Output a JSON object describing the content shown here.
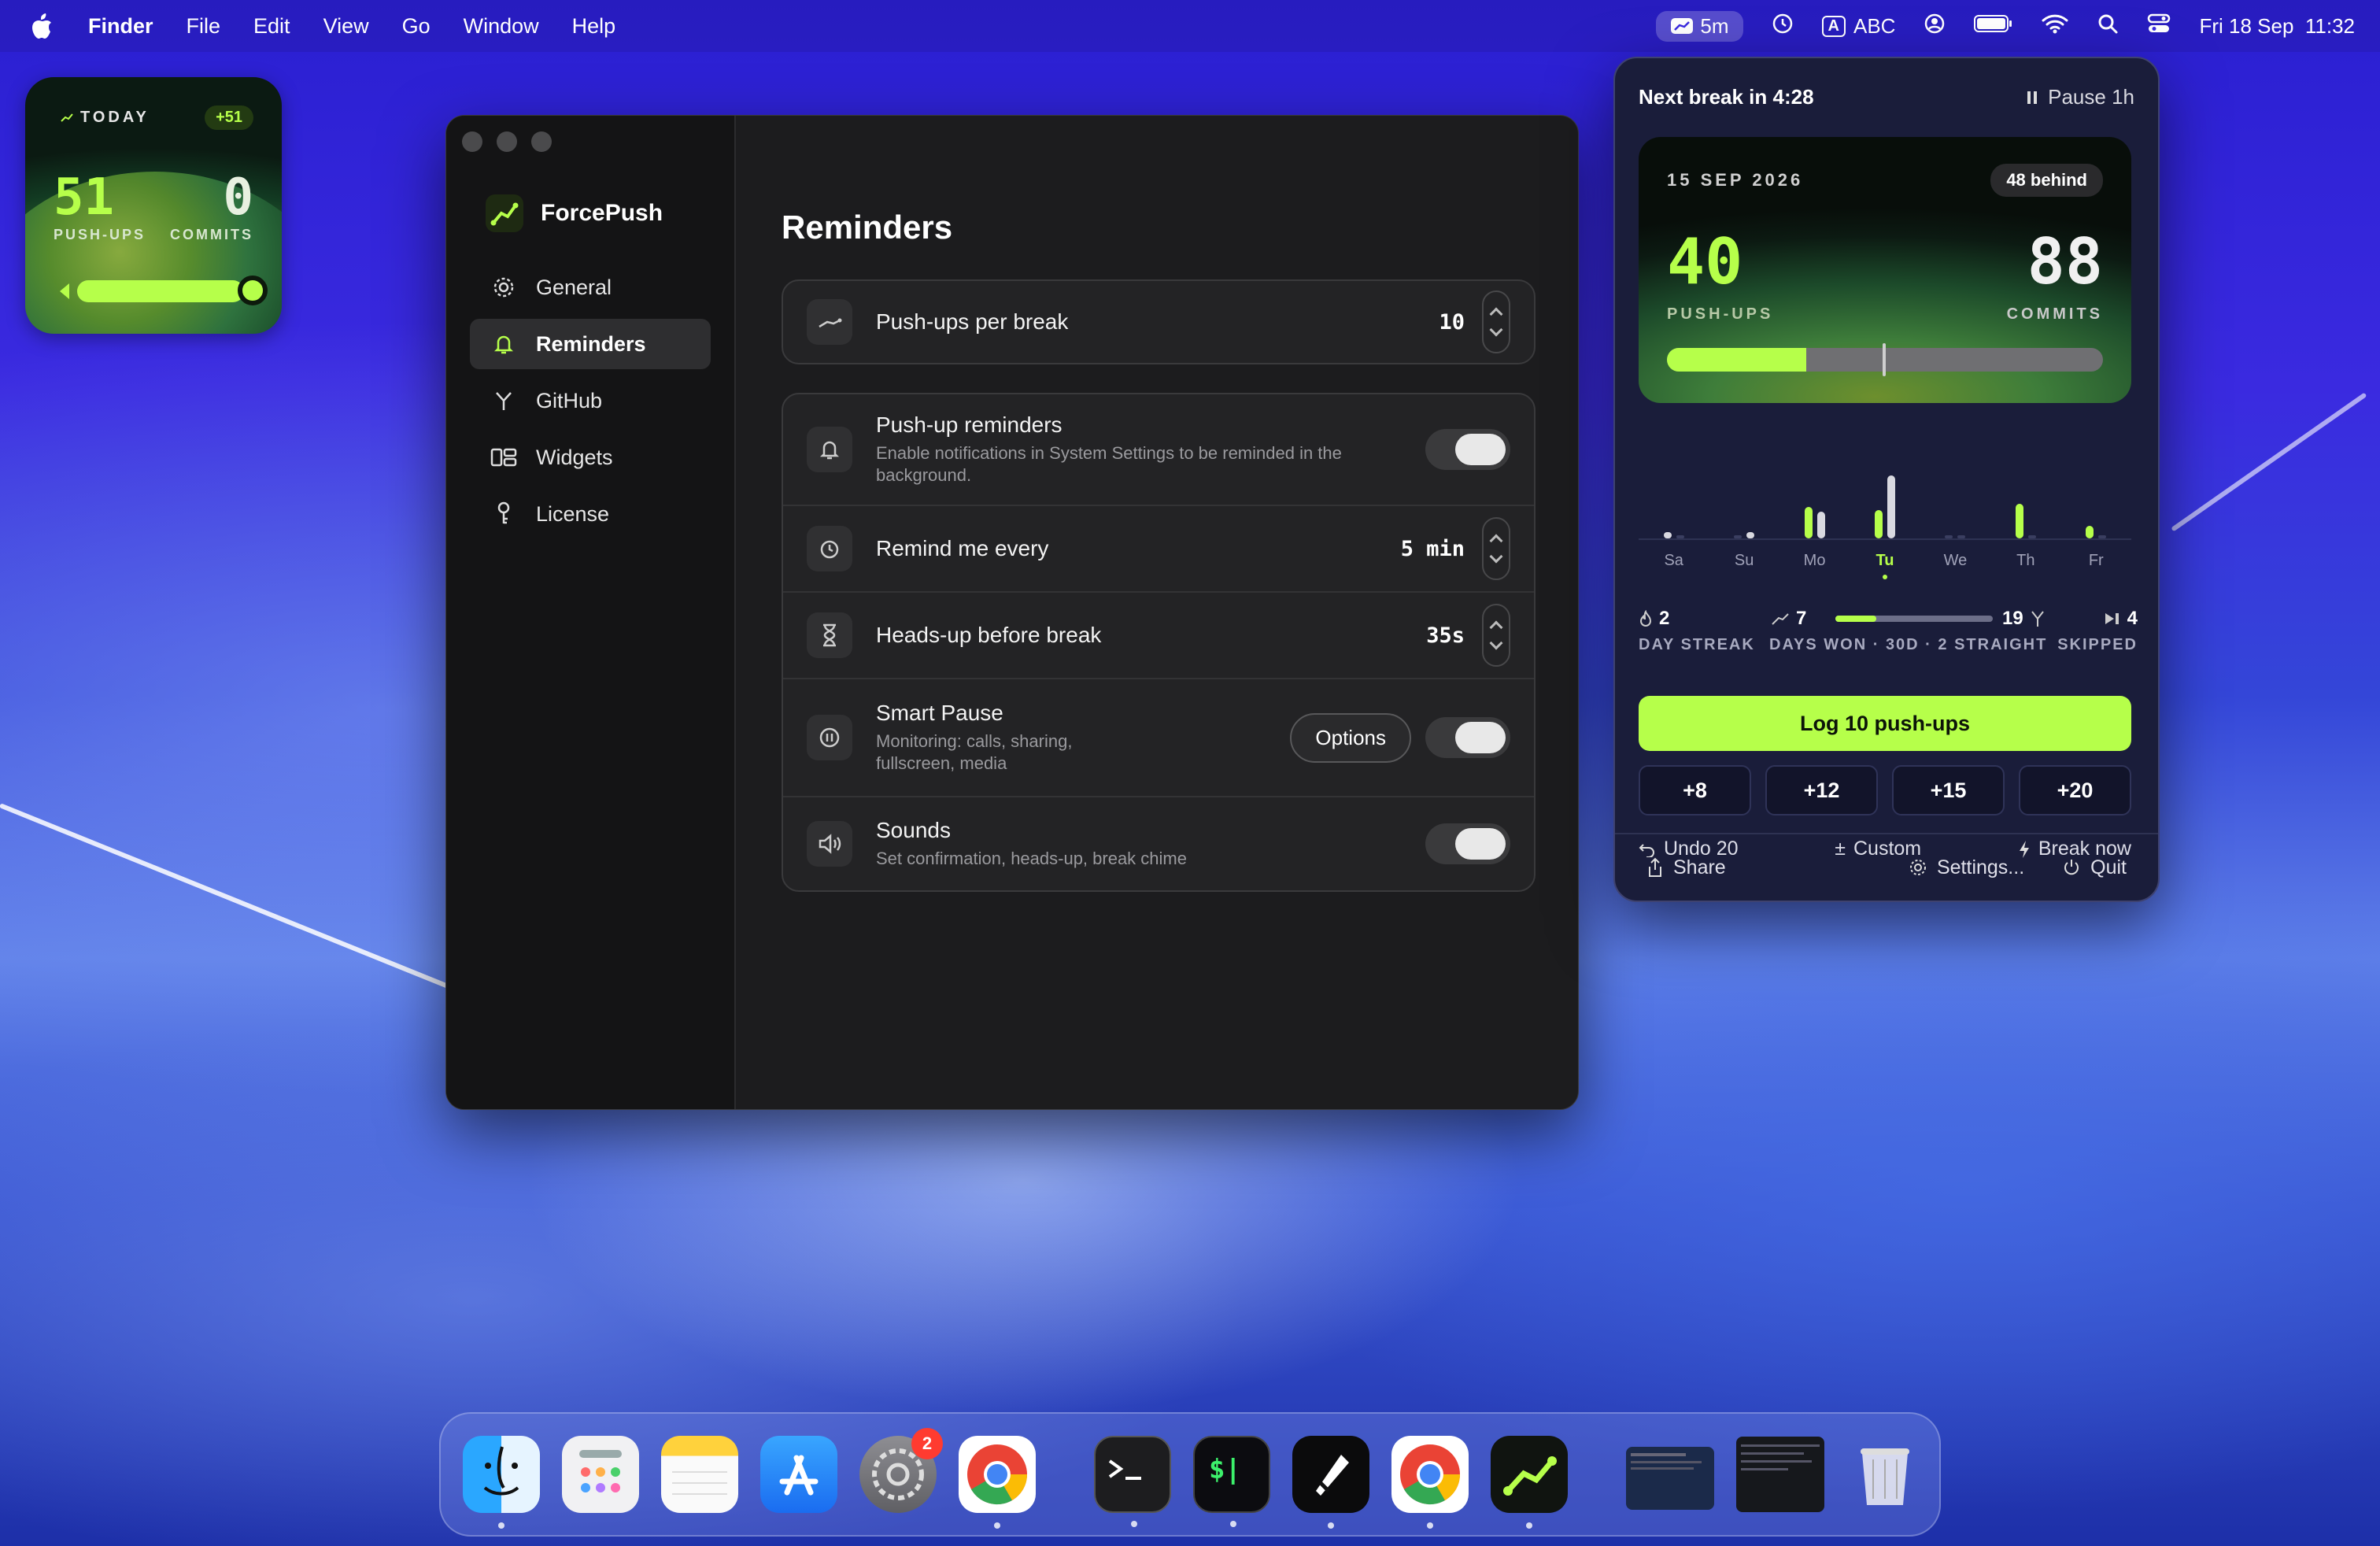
{
  "menubar": {
    "app": "Finder",
    "menus": [
      "File",
      "Edit",
      "View",
      "Go",
      "Window",
      "Help"
    ],
    "timer": "5m",
    "input_source_letter": "A",
    "input_source": "ABC",
    "clock": "Fri 18 Sep  11:32"
  },
  "widget": {
    "label": "TODAY",
    "badge": "+51",
    "pushups": "51",
    "pushups_label": "PUSH-UPS",
    "commits": "0",
    "commits_label": "COMMITS"
  },
  "window": {
    "app_name": "ForcePush",
    "sidebar": [
      {
        "label": "General",
        "icon": "gear-icon"
      },
      {
        "label": "Reminders",
        "icon": "bell-icon",
        "active": true
      },
      {
        "label": "GitHub",
        "icon": "branch-icon"
      },
      {
        "label": "Widgets",
        "icon": "widgets-icon"
      },
      {
        "label": "License",
        "icon": "key-icon"
      }
    ],
    "title": "Reminders",
    "pushups_per_break": {
      "label": "Push-ups per break",
      "value": "10"
    },
    "rows": {
      "reminders": {
        "title": "Push-up reminders",
        "desc": "Enable notifications in System Settings to be reminded in the background."
      },
      "remind_every": {
        "title": "Remind me every",
        "value": "5 min"
      },
      "heads_up": {
        "title": "Heads-up before break",
        "value": "35s"
      },
      "smart_pause": {
        "title": "Smart Pause",
        "desc": "Monitoring: calls, sharing, fullscreen, media",
        "button": "Options"
      },
      "sounds": {
        "title": "Sounds",
        "desc": "Set confirmation, heads-up, break chime"
      }
    }
  },
  "popover": {
    "next_break": "Next break in 4:28",
    "pause": "Pause 1h",
    "hero": {
      "date": "15 SEP 2026",
      "behind": "48 behind",
      "pushups": "40",
      "pushups_label": "PUSH-UPS",
      "commits": "88",
      "commits_label": "COMMITS",
      "progress": 0.32
    },
    "week": [
      {
        "day": "Sa",
        "push": 0.05,
        "commit": 0
      },
      {
        "day": "Su",
        "push": 0,
        "commit": 0.05
      },
      {
        "day": "Mo",
        "push": 0.5,
        "commit": 0.42
      },
      {
        "day": "Tu",
        "push": 0.45,
        "commit": 1.0,
        "active": true
      },
      {
        "day": "We",
        "push": 0,
        "commit": 0
      },
      {
        "day": "Th",
        "push": 0.55,
        "commit": 0
      },
      {
        "day": "Fr",
        "push": 0.2,
        "commit": 0
      }
    ],
    "stats": {
      "streak": "2",
      "streak_label": "DAY STREAK",
      "won_left": "7",
      "won_right": "19",
      "won_label": "DAYS WON · 30D · 2 STRAIGHT",
      "skipped": "4",
      "skipped_label": "SKIPPED"
    },
    "log_button": "Log 10 push-ups",
    "increments": [
      "+8",
      "+12",
      "+15",
      "+20"
    ],
    "actions": {
      "undo": "Undo 20",
      "custom": "Custom",
      "break": "Break now"
    },
    "footer": {
      "share": "Share",
      "settings": "Settings...",
      "quit": "Quit"
    }
  },
  "colors": {
    "accent": "#b6ff4a",
    "window_bg": "#1c1c1e",
    "popover_bg": "#1a1d3a"
  }
}
